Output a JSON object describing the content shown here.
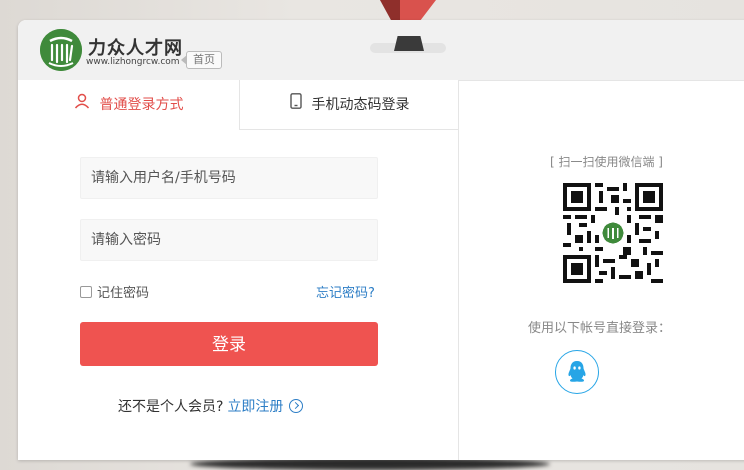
{
  "brand": {
    "name": "力众人才网",
    "url": "www.lizhongrcw.com",
    "home_label": "首页",
    "logo_icon": "lizhong-logo-icon"
  },
  "tabs": [
    {
      "label": "普通登录方式",
      "icon": "user-icon",
      "active": true
    },
    {
      "label": "手机动态码登录",
      "icon": "phone-icon",
      "active": false
    }
  ],
  "form": {
    "username_placeholder": "请输入用户名/手机号码",
    "password_placeholder": "请输入密码",
    "remember_label": "记住密码",
    "forgot_label": "忘记密码?",
    "submit_label": "登录",
    "register_prompt": "还不是个人会员?",
    "register_link": "立即注册"
  },
  "qr_section": {
    "scan_label": "[ 扫一扫使用微信端 ]",
    "other_login_label": "使用以下帐号直接登录：",
    "qq_icon": "qq-icon"
  },
  "colors": {
    "accent_red": "#ef5350",
    "tab_active": "#e24e4a",
    "link_blue": "#2d7ec6",
    "qq_blue": "#27a5e6",
    "logo_green": "#3f8a3b"
  }
}
